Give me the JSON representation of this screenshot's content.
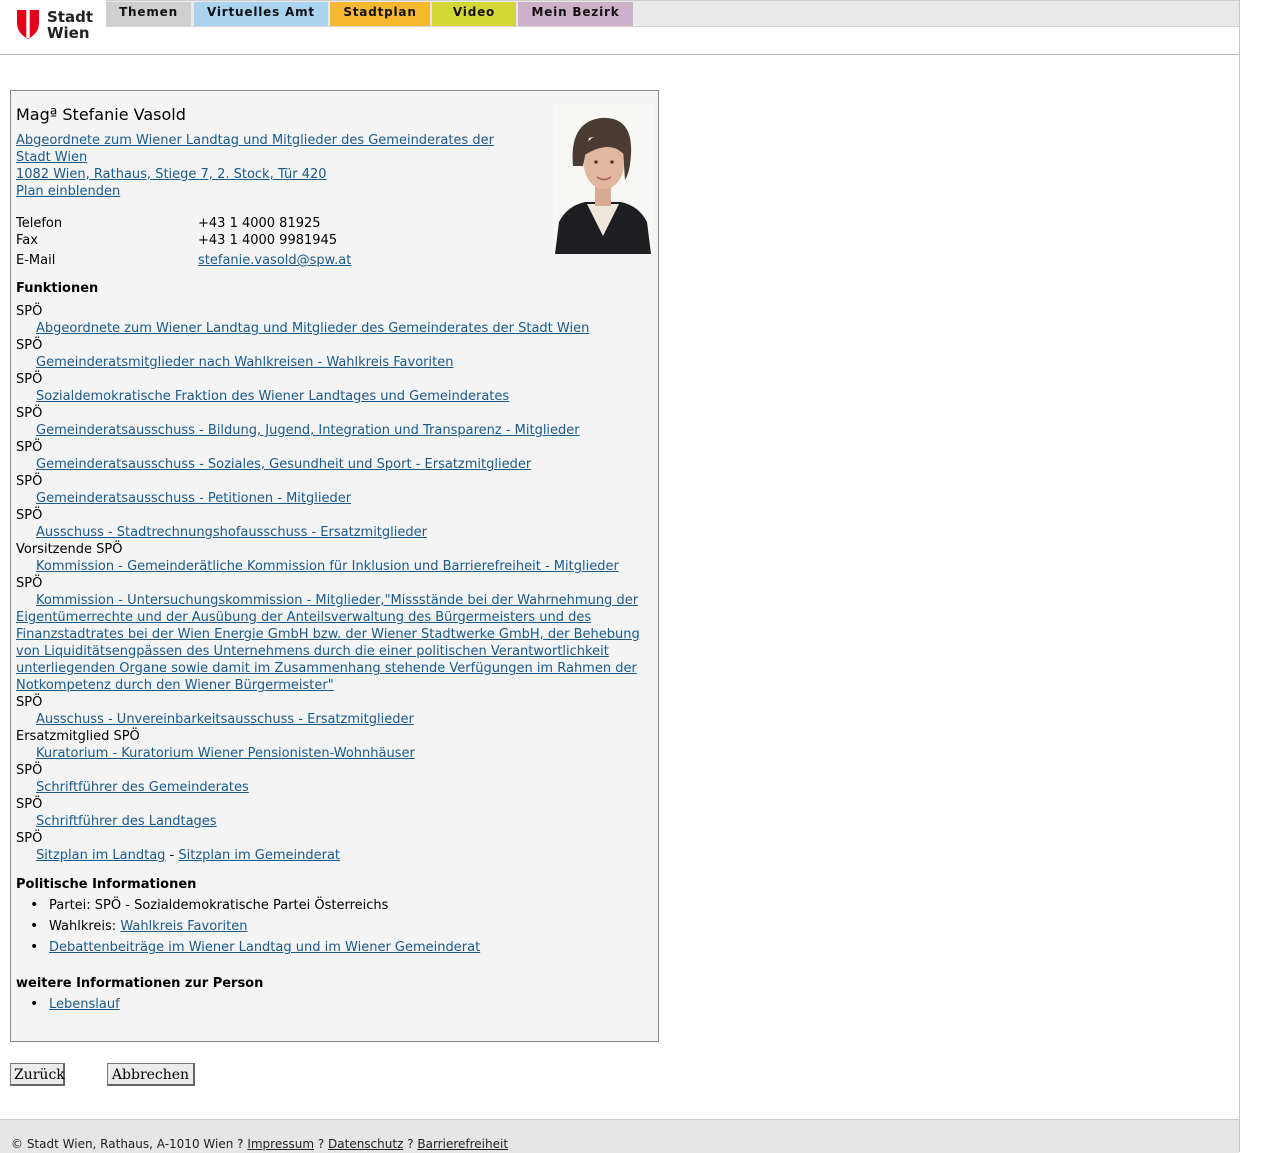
{
  "header": {
    "logo_line1": "Stadt",
    "logo_line2": "Wien",
    "tabs": [
      {
        "label": "Themen",
        "color": "#cfcfcf"
      },
      {
        "label": "Virtuelles Amt",
        "color": "#a9d3ef"
      },
      {
        "label": "Stadtplan",
        "color": "#f5b82e"
      },
      {
        "label": "Video",
        "color": "#d4d836"
      },
      {
        "label": "Mein Bezirk",
        "color": "#cdb0c9"
      }
    ]
  },
  "person": {
    "name": "Magª Stefanie Vasold",
    "position_line": "Abgeordnete zum Wiener Landtag und Mitglieder des Gemeinderates der Stadt Wien ",
    "address": "1082 Wien, Rathaus, Stiege 7, 2. Stock, Tür 420",
    "plan_link": "Plan einblenden",
    "contact": [
      {
        "label": "Telefon",
        "value": "+43 1 4000 81925"
      },
      {
        "label": "Fax",
        "value": "+43 1 4000 9981945"
      },
      {
        "label": "E-Mail",
        "value": "stefanie.vasold@spw.at"
      }
    ]
  },
  "functions": {
    "heading": "Funktionen",
    "items": [
      {
        "role": "SPÖ",
        "link": "Abgeordnete zum Wiener Landtag und Mitglieder des Gemeinderates der Stadt Wien"
      },
      {
        "role": "SPÖ",
        "link": "Gemeinderatsmitglieder nach Wahlkreisen - Wahlkreis Favoriten"
      },
      {
        "role": "SPÖ",
        "link": "Sozialdemokratische Fraktion des Wiener Landtages und Gemeinderates"
      },
      {
        "role": "SPÖ",
        "link": "Gemeinderatsausschuss - Bildung, Jugend, Integration und Transparenz - Mitglieder"
      },
      {
        "role": "SPÖ",
        "link": "Gemeinderatsausschuss - Soziales, Gesundheit und Sport - Ersatzmitglieder"
      },
      {
        "role": "SPÖ",
        "link": "Gemeinderatsausschuss - Petitionen - Mitglieder"
      },
      {
        "role": "SPÖ",
        "link": "Ausschuss - Stadtrechnungshofausschuss - Ersatzmitglieder"
      },
      {
        "role": "Vorsitzende SPÖ",
        "link": "Kommission - Gemeinderätliche Kommission für Inklusion und Barrierefreiheit - Mitglieder"
      },
      {
        "role": "SPÖ",
        "link": "Kommission - Untersuchungskommission - Mitglieder,\"Missstände bei der Wahrnehmung der Eigentümerrechte und der Ausübung der Anteilsverwaltung des Bürgermeisters und des Finanzstadtrates bei der Wien Energie GmbH bzw. der Wiener Stadtwerke GmbH, der Behebung von Liquiditätsengpässen des Unternehmens durch die einer politischen Verantwortlichkeit unterliegenden Organe sowie damit im Zusammenhang stehende Verfügungen im Rahmen der Notkompetenz durch den Wiener Bürgermeister\""
      },
      {
        "role": "SPÖ",
        "link": "Ausschuss - Unvereinbarkeitsausschuss - Ersatzmitglieder"
      },
      {
        "role": "Ersatzmitglied SPÖ",
        "link": "Kuratorium - Kuratorium Wiener Pensionisten-Wohnhäuser"
      },
      {
        "role": "SPÖ",
        "link": "Schriftführer des Gemeinderates"
      },
      {
        "role": "SPÖ",
        "link": "Schriftführer des Landtages"
      }
    ],
    "last_role": "SPÖ",
    "seat_link_1": "Sitzplan im Landtag",
    "seat_sep": " - ",
    "seat_link_2": "Sitzplan im Gemeinderat"
  },
  "political": {
    "heading": "Politische Informationen",
    "party": "Partei: SPÖ - Sozialdemokratische Partei Österreichs",
    "district_label": "Wahlkreis: ",
    "district_link": "Wahlkreis Favoriten",
    "debate_link": "Debattenbeiträge im Wiener Landtag und im Wiener Gemeinderat"
  },
  "more": {
    "heading": "weitere Informationen zur Person",
    "cv_link": "Lebenslauf"
  },
  "buttons": {
    "back": "Zurück",
    "cancel": "Abbrechen"
  },
  "footer": {
    "copyright": "© Stadt Wien, Rathaus, A-1010 Wien ? ",
    "impressum": "Impressum",
    "sep": " ? ",
    "datenschutz": "Datenschutz",
    "barriere": "Barrierefreiheit"
  }
}
